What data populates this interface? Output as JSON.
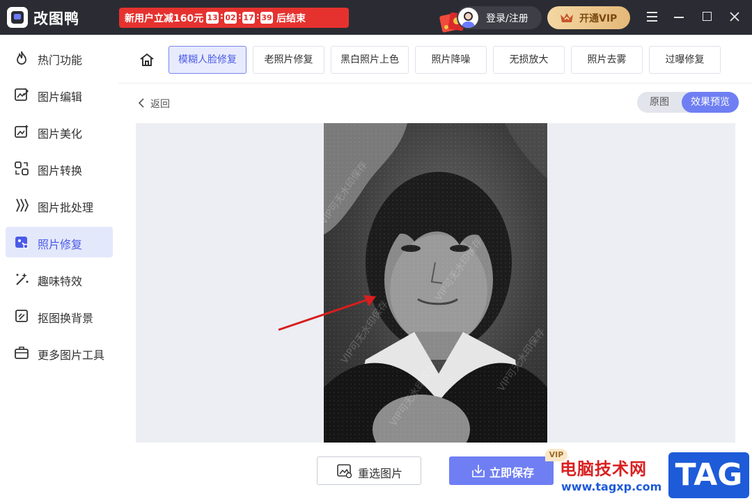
{
  "app": {
    "name": "改图鸭"
  },
  "promo": {
    "text": "新用户立减160元",
    "countdown": [
      "13",
      "02",
      "17",
      "39"
    ],
    "suffix": "后结束"
  },
  "header": {
    "login_label": "登录/注册",
    "vip_label": "开通VIP"
  },
  "sidebar": {
    "items": [
      {
        "label": "热门功能",
        "icon": "flame-icon"
      },
      {
        "label": "图片编辑",
        "icon": "image-edit-icon"
      },
      {
        "label": "图片美化",
        "icon": "image-beautify-icon"
      },
      {
        "label": "图片转换",
        "icon": "convert-icon"
      },
      {
        "label": "图片批处理",
        "icon": "batch-icon"
      },
      {
        "label": "照片修复",
        "icon": "photo-repair-icon",
        "active": true
      },
      {
        "label": "趣味特效",
        "icon": "magic-wand-icon"
      },
      {
        "label": "抠图换背景",
        "icon": "cutout-icon"
      },
      {
        "label": "更多图片工具",
        "icon": "toolbox-icon"
      }
    ]
  },
  "tools": {
    "tabs": [
      {
        "label": "模糊人脸修复",
        "active": true
      },
      {
        "label": "老照片修复"
      },
      {
        "label": "黑白照片上色"
      },
      {
        "label": "照片降噪"
      },
      {
        "label": "无损放大"
      },
      {
        "label": "照片去雾"
      },
      {
        "label": "过曝修复"
      }
    ]
  },
  "preview": {
    "back_label": "返回",
    "toggle": {
      "original": "原图",
      "effect": "效果预览",
      "selected": "效果预览"
    },
    "watermark_text": "VIP可无水印保存"
  },
  "actions": {
    "reselect_label": "重选图片",
    "save_label": "立即保存",
    "vip_badge": "VIP"
  },
  "site_watermark": {
    "cn": "电脑技术网",
    "url": "www.tagxp.com",
    "tag": "TAG"
  },
  "colors": {
    "accent": "#6f7ff3",
    "titlebar": "#2b2c33",
    "promo_red": "#e5322f",
    "active_bg": "#e4e8fb"
  }
}
